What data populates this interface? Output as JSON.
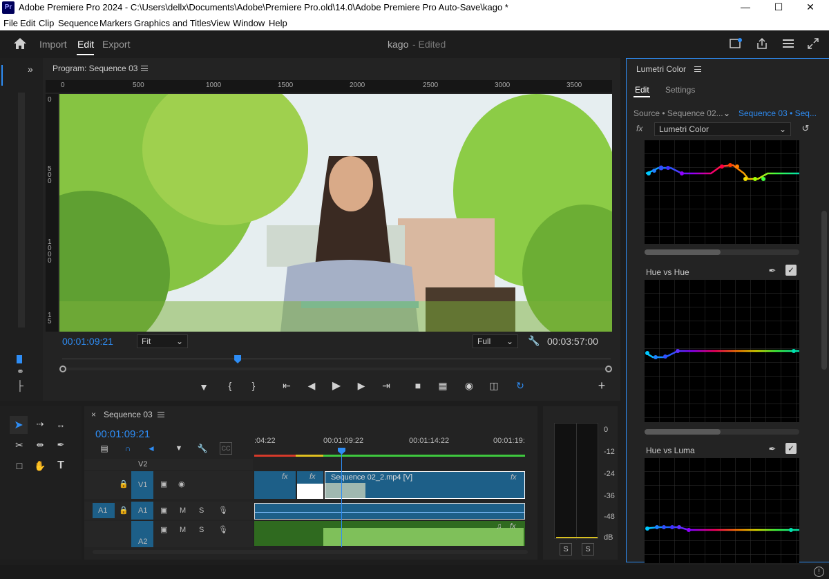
{
  "window": {
    "title": "Adobe Premiere Pro 2024 - C:\\Users\\dellx\\Documents\\Adobe\\Premiere Pro.old\\14.0\\Adobe Premiere Pro Auto-Save\\kago *",
    "logo": "Pr"
  },
  "menu": [
    "File",
    "Edit",
    "Clip",
    "Sequence",
    "Markers",
    "Graphics and Titles",
    "View",
    "Window",
    "Help"
  ],
  "workspace": {
    "tabs": [
      "Import",
      "Edit",
      "Export"
    ],
    "active": "Edit",
    "project": "kago",
    "status": "- Edited"
  },
  "program": {
    "title": "Program: Sequence 03",
    "ruler_labels": [
      "0",
      "500",
      "1000",
      "1500",
      "2000",
      "2500",
      "3000",
      "3500"
    ],
    "vruler_labels": [
      "0",
      "5\n0\n0",
      "1\n0\n0\n0",
      "1\n5"
    ],
    "timecode": "00:01:09:21",
    "fit": "Fit",
    "quality": "Full",
    "duration": "00:03:57:00",
    "playhead_fraction": 0.32,
    "scene": {
      "sky": "#e8f0f4",
      "foliage": "#7fbf3a",
      "wall": "#d8b8a0",
      "hair": "#3a2a22",
      "sweater": "#9aa8c0"
    }
  },
  "timeline": {
    "title": "Sequence 03",
    "timecode": "00:01:09:21",
    "ruler": [
      ":04:22",
      "00:01:09:22",
      "00:01:14:22",
      "00:01:19:"
    ],
    "tracks": [
      {
        "name": "V2",
        "label": ""
      },
      {
        "name": "V1",
        "label": "V1"
      },
      {
        "name": "A1",
        "label": "A1",
        "source": "A1"
      },
      {
        "name": "A2",
        "label": "A2"
      }
    ],
    "clip_label": "Sequence 02_2.mp4 [V]",
    "fx": "fx",
    "mute": "M",
    "solo": "S"
  },
  "meter": {
    "ticks": [
      "0",
      "-12",
      "-24",
      "-36",
      "-48",
      "dB"
    ],
    "solo": [
      "S",
      "S"
    ]
  },
  "lumetri": {
    "title": "Lumetri Color",
    "tabs": [
      "Edit",
      "Settings"
    ],
    "source": "Source • Sequence 02...",
    "sequence": "Sequence 03 • Seq...",
    "effect": "Lumetri Color",
    "fx": "fx",
    "curves": [
      {
        "name": "Hue vs Hue"
      },
      {
        "name": "Hue vs Luma"
      }
    ]
  },
  "colors": {
    "accent": "#2e8df5",
    "clip": "#1d5f88",
    "audio": "#2f6a1f",
    "panel": "#232323"
  }
}
